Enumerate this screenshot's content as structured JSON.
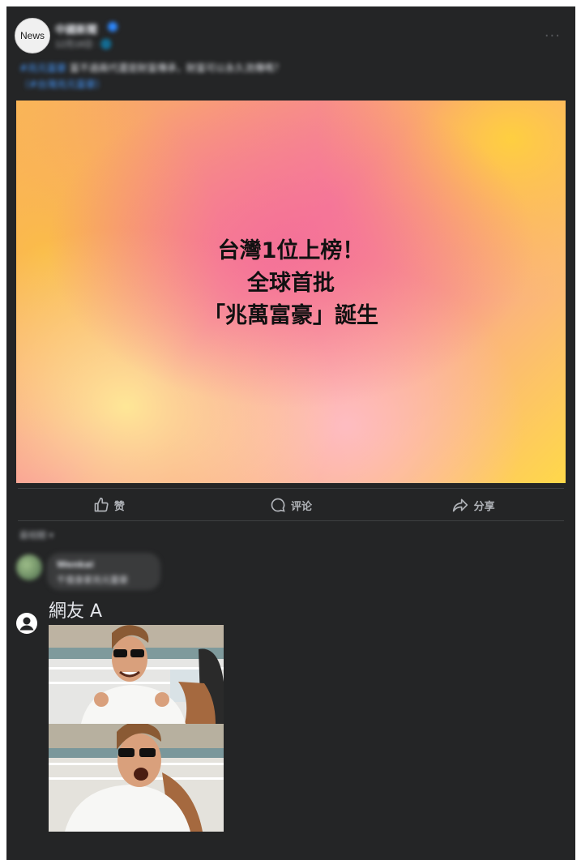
{
  "header": {
    "avatar_text": "News",
    "page_name": "中國新聞",
    "meta": "12月18日 · 🌐",
    "more_label": "···"
  },
  "caption": {
    "hashtag": "#兆元富豪",
    "text": " 富不過兩代還是財富傳承，財富可以永久流傳嗎？",
    "link": "（#台灣兆元富豪）"
  },
  "image": {
    "headline": [
      "台灣1位上榜！",
      "全球首批",
      "「兆萬富豪」誕生"
    ]
  },
  "actions": [
    {
      "label": "赞",
      "icon": "like-icon"
    },
    {
      "label": "评论",
      "icon": "comment-icon"
    },
    {
      "label": "分享",
      "icon": "share-icon"
    }
  ],
  "comments": {
    "sort_label": "最相關 ▾",
    "first": {
      "name": "Wenkai",
      "text": "千億身家兆元富豪"
    },
    "second": {
      "name": "網友 A",
      "image": "meme-image"
    }
  },
  "colors": {
    "background": "#242526",
    "text": "#e4e6eb",
    "muted": "#b0b3b8",
    "link": "#4599ff"
  }
}
